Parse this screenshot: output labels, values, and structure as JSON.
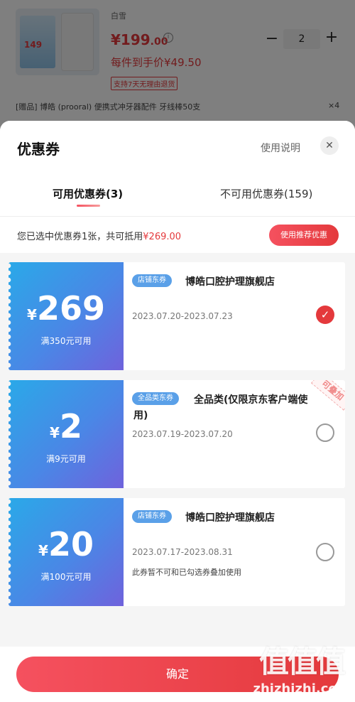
{
  "product": {
    "variant": "白雪",
    "price_int": "¥199",
    "price_dec": ".00",
    "info_icon": "info-icon",
    "unit_price": "每件到手价¥49.50",
    "return_badge": "支持7天无理由退货",
    "quantity": "2",
    "minus_label": "−",
    "plus_label": "+",
    "image_price": "149",
    "gift": "[赠品]  博皓 (prooral)  便携式冲牙器配件 牙线棒50支",
    "gift_count": "×4"
  },
  "sheet": {
    "title": "优惠券",
    "usage_link": "使用说明",
    "close_label": "✕",
    "tabs": [
      {
        "label": "可用优惠券(3)",
        "active": true
      },
      {
        "label": "不可用优惠券(159)",
        "active": false
      }
    ],
    "summary_prefix": "您已选中优惠券1张，共可抵用",
    "summary_amount": "¥269.00",
    "recommend_label": "使用推荐优惠"
  },
  "coupons": [
    {
      "yen": "¥",
      "amount": "269",
      "condition": "满350元可用",
      "tag": "店铺东券",
      "name": "博皓口腔护理旗舰店",
      "name_line2": "",
      "date": "2023.07.20-2023.07.23",
      "note": "",
      "selected": true,
      "check_mark": "✓"
    },
    {
      "yen": "¥",
      "amount": "2",
      "condition": "满9元可用",
      "tag": "全品类东券",
      "name": "全品类(仅限京东客户端使",
      "name_line2": "用)",
      "date": "2023.07.19-2023.07.20",
      "note": "",
      "selected": false,
      "badge": "可叠加"
    },
    {
      "yen": "¥",
      "amount": "20",
      "condition": "满100元可用",
      "tag": "店铺东券",
      "name": "博皓口腔护理旗舰店",
      "name_line2": "",
      "date": "2023.07.17-2023.08.31",
      "note": "此券暂不可和已勾选券叠加使用",
      "selected": false
    }
  ],
  "footer": {
    "confirm_label": "确定"
  },
  "watermark": {
    "logo": "值值值",
    "site": "zhizhizhi.com"
  }
}
